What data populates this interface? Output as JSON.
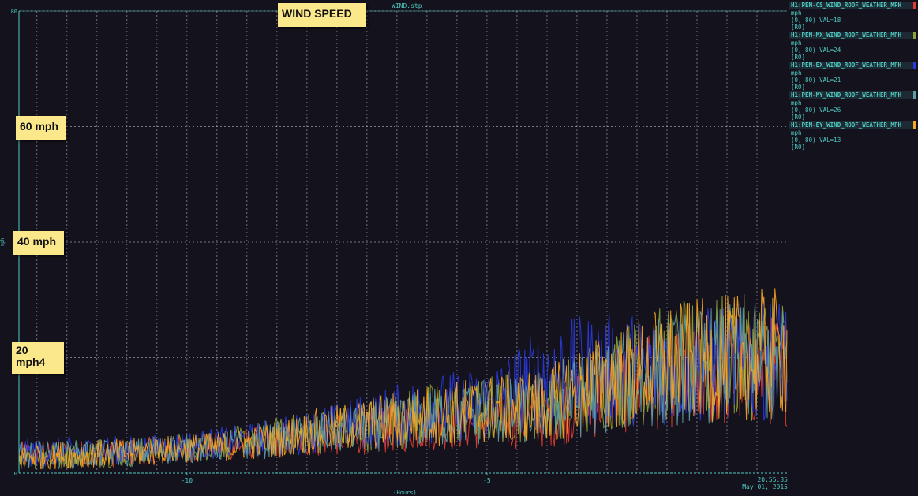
{
  "window": {
    "title": "WIND.stp"
  },
  "notes": [
    {
      "id": "title",
      "text": "WIND SPEED"
    },
    {
      "id": "n60",
      "text": "60 mph"
    },
    {
      "id": "n40",
      "text": "40 mph"
    },
    {
      "id": "n20",
      "text": "20\nmph4"
    }
  ],
  "time_readout": {
    "time": "20:55:35",
    "date": "May 01, 2015"
  },
  "chart_data": {
    "type": "line",
    "xlabel": "(Hours)",
    "ylabel": "mph",
    "xlim": [
      -12.8,
      0
    ],
    "ylim": [
      0,
      80
    ],
    "x_ticks": [
      -10,
      -5
    ],
    "y_ticks": [
      0,
      20,
      40,
      60,
      80
    ],
    "y_tick_labels": [
      "0",
      "",
      "",
      "",
      "80"
    ],
    "grid": true,
    "legend_position": "right",
    "series": [
      {
        "name": "H1:PEM-CS_WIND_ROOF_WEATHER_MPH",
        "color": "#e03c31",
        "units": "mph",
        "range": "(0, 80)",
        "value_text": "VAL=18",
        "flag": "[RO]",
        "profile_x": [
          -12.8,
          -11,
          -9,
          -8,
          -7,
          -6,
          -5,
          -4,
          -3,
          -2,
          -1,
          0
        ],
        "profile_y": [
          3,
          3.5,
          5,
          6,
          7,
          8.5,
          9,
          9.5,
          14,
          17,
          17,
          18
        ]
      },
      {
        "name": "H1:PEM-MX_WIND_ROOF_WEATHER_MPH",
        "color": "#8ea33a",
        "units": "mph",
        "range": "(0, 80)",
        "value_text": "VAL=24",
        "flag": "[RO]",
        "profile_x": [
          -12.8,
          -11,
          -9,
          -8,
          -7,
          -6,
          -5,
          -4,
          -3,
          -2,
          -1,
          0
        ],
        "profile_y": [
          3,
          3.5,
          5.5,
          7,
          8,
          10,
          11,
          12,
          16,
          19,
          20,
          20
        ]
      },
      {
        "name": "H1:PEM-EX_WIND_ROOF_WEATHER_MPH",
        "color": "#2a3ae0",
        "units": "mph",
        "range": "(0, 80)",
        "value_text": "VAL=21",
        "flag": "[RO]",
        "profile_x": [
          -12.8,
          -11,
          -9,
          -8,
          -7,
          -6,
          -5,
          -4,
          -3,
          -2,
          -1,
          0
        ],
        "profile_y": [
          3.5,
          4,
          5.5,
          7,
          9,
          11,
          12,
          17,
          18,
          18,
          19,
          20
        ]
      },
      {
        "name": "H1:PEM-MY_WIND_ROOF_WEATHER_MPH",
        "color": "#5e9ea8",
        "units": "mph",
        "range": "(0, 80)",
        "value_text": "VAL=26",
        "flag": "[RO]",
        "profile_x": [
          -12.8,
          -11,
          -9,
          -8,
          -7,
          -6,
          -5,
          -4,
          -3,
          -2,
          -1,
          0
        ],
        "profile_y": [
          3,
          3.5,
          5,
          6.5,
          8,
          9.5,
          10.5,
          11,
          15,
          18,
          19,
          19
        ]
      },
      {
        "name": "H1:PEM-EY_WIND_ROOF_WEATHER_MPH",
        "color": "#f6a623",
        "units": "mph",
        "range": "(0, 80)",
        "value_text": "VAL=13",
        "flag": "[RO]",
        "profile_x": [
          -12.8,
          -11,
          -9,
          -8,
          -7,
          -6,
          -5,
          -4,
          -3,
          -2,
          -1,
          0
        ],
        "profile_y": [
          3,
          3.5,
          5,
          7,
          8.5,
          10,
          11,
          12,
          16,
          19,
          20,
          21
        ]
      }
    ]
  }
}
